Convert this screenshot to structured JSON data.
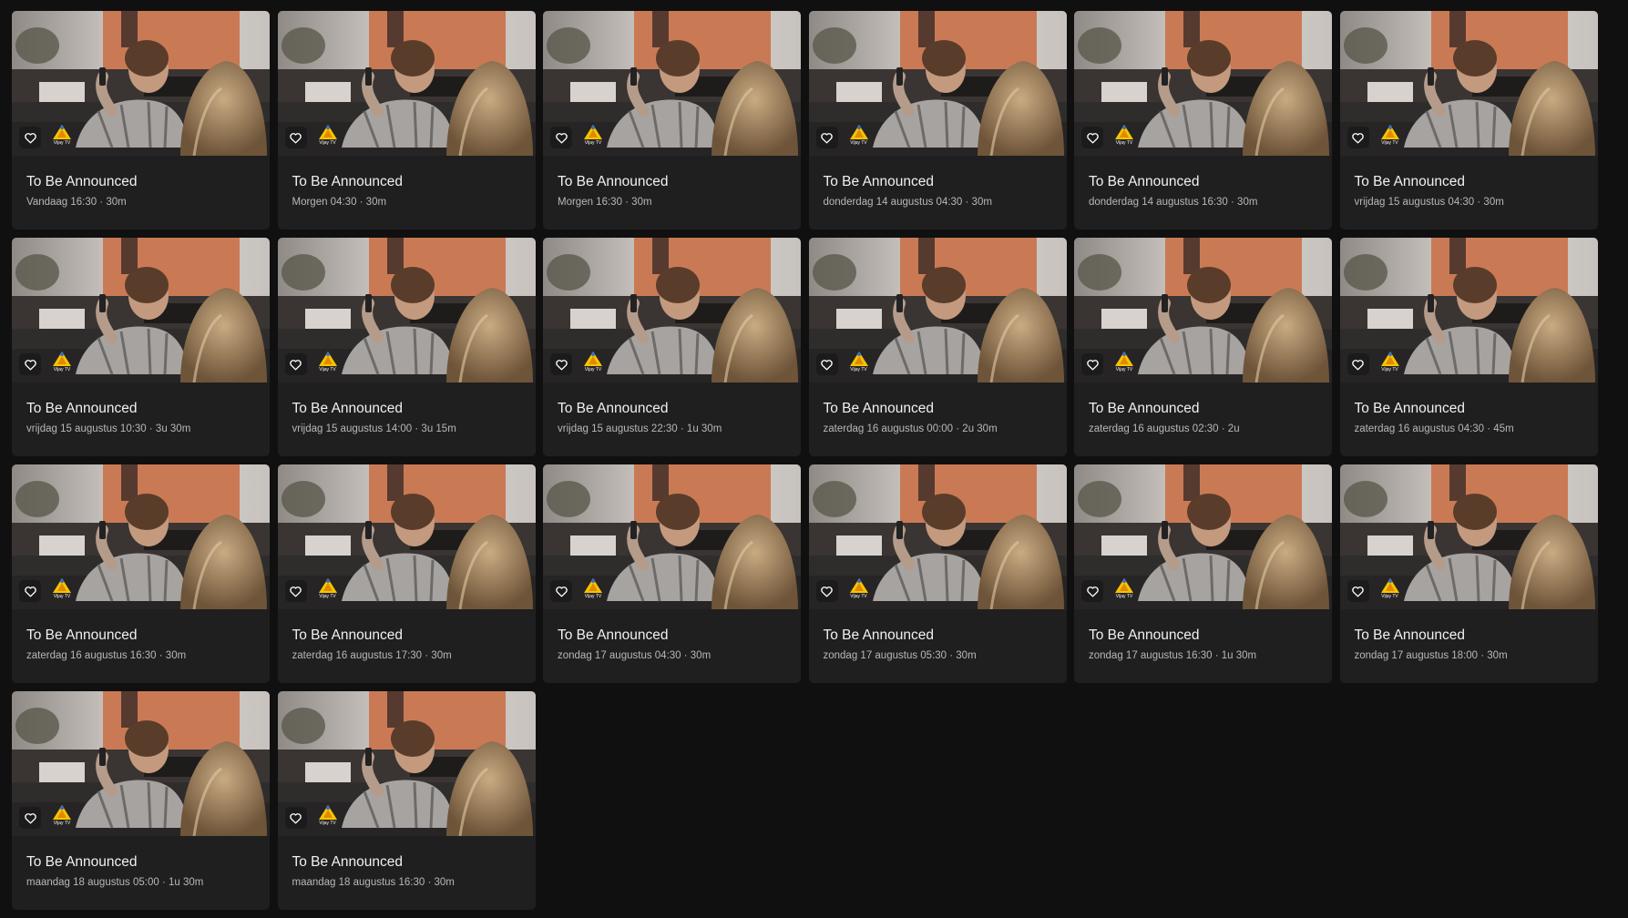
{
  "colors": {
    "background": "#101010",
    "card": "#1f1f1f",
    "title": "#f1f1f1",
    "meta": "#b8b8b8",
    "logo_accent": "#f6c400"
  },
  "icons": {
    "favorite": "heart-outline-icon",
    "channel_logo": "vijay-tv-logo"
  },
  "channel": {
    "logo_text": "Vijay TV"
  },
  "cards": [
    {
      "title": "To Be Announced",
      "meta": "Vandaag 16:30 · 30m"
    },
    {
      "title": "To Be Announced",
      "meta": "Morgen 04:30 · 30m"
    },
    {
      "title": "To Be Announced",
      "meta": "Morgen 16:30 · 30m"
    },
    {
      "title": "To Be Announced",
      "meta": "donderdag 14 augustus 04:30 · 30m"
    },
    {
      "title": "To Be Announced",
      "meta": "donderdag 14 augustus 16:30 · 30m"
    },
    {
      "title": "To Be Announced",
      "meta": "vrijdag 15 augustus 04:30 · 30m"
    },
    {
      "title": "To Be Announced",
      "meta": "vrijdag 15 augustus 10:30 · 3u 30m"
    },
    {
      "title": "To Be Announced",
      "meta": "vrijdag 15 augustus 14:00 · 3u 15m"
    },
    {
      "title": "To Be Announced",
      "meta": "vrijdag 15 augustus 22:30 · 1u 30m"
    },
    {
      "title": "To Be Announced",
      "meta": "zaterdag 16 augustus 00:00 · 2u 30m"
    },
    {
      "title": "To Be Announced",
      "meta": "zaterdag 16 augustus 02:30 · 2u"
    },
    {
      "title": "To Be Announced",
      "meta": "zaterdag 16 augustus 04:30 · 45m"
    },
    {
      "title": "To Be Announced",
      "meta": "zaterdag 16 augustus 16:30 · 30m"
    },
    {
      "title": "To Be Announced",
      "meta": "zaterdag 16 augustus 17:30 · 30m"
    },
    {
      "title": "To Be Announced",
      "meta": "zondag 17 augustus 04:30 · 30m"
    },
    {
      "title": "To Be Announced",
      "meta": "zondag 17 augustus 05:30 · 30m"
    },
    {
      "title": "To Be Announced",
      "meta": "zondag 17 augustus 16:30 · 1u 30m"
    },
    {
      "title": "To Be Announced",
      "meta": "zondag 17 augustus 18:00 · 30m"
    },
    {
      "title": "To Be Announced",
      "meta": "maandag 18 augustus 05:00 · 1u 30m"
    },
    {
      "title": "To Be Announced",
      "meta": "maandag 18 augustus 16:30 · 30m"
    }
  ]
}
